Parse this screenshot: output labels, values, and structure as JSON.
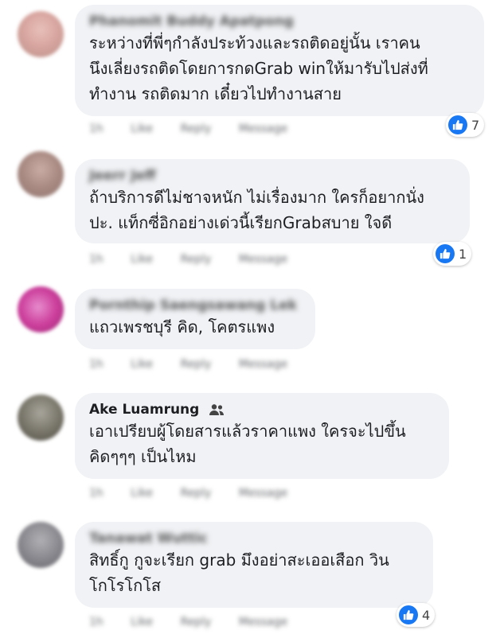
{
  "accent_color": "#1877f2",
  "comments": [
    {
      "author": "Phanomit Buddy Apatpong",
      "text": "ระหว่างที่พี่ๆกำลังประท้วงและรถติดอยู่นั้น เราคน\nนึงเลี่ยงรถติดโดยการกดGrab winให้มารับไปส่งที่\nทำงาน รถติดมาก เดี๋ยวไปทำงานสาย",
      "actions": [
        "1h",
        "Like",
        "Reply",
        "Message"
      ],
      "reactions": "7"
    },
    {
      "author": "Jeerr Jeff",
      "text": "ถ้าบริการดีไม่ชาจหนัก ไม่เรื่องมาก ใครก็อยากนั่ง\nปะ. แท็กซี่อิกอย่างเด่วนี้เรียกGrabสบาย ใจดี",
      "actions": [
        "1h",
        "Like",
        "Reply",
        "Message"
      ],
      "reactions": "1"
    },
    {
      "author": "Pornthip Saengsawang Lek",
      "text": "แถวเพรชบุรี คิด, โคตรแพง",
      "actions": [
        "1h",
        "Like",
        "Reply",
        "Message"
      ]
    },
    {
      "author": "Ake Luamrung",
      "text": "เอาเปรียบผู้โดยสารแล้วราคาแพง ใครจะไปขึ้น\nคิดๆๆๆ เป็นไหม",
      "actions": [
        "1h",
        "Like",
        "Reply",
        "Message"
      ]
    },
    {
      "author": "Tanawat Wuttic",
      "text": "สิทธิ์กู กูจะเรียก grab มึงอย่าสะเออเสือก วิน\nโกโรโกโส",
      "actions": [
        "1h",
        "Like",
        "Reply",
        "Message"
      ],
      "reactions": "4"
    }
  ]
}
